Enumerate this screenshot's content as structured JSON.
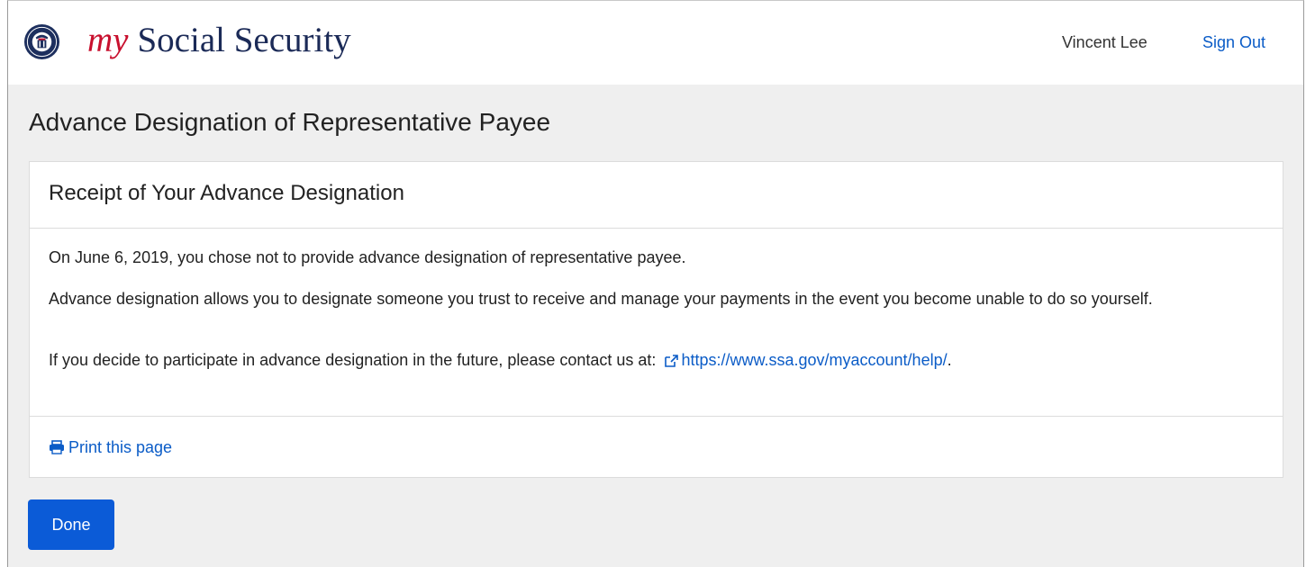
{
  "header": {
    "brand_my": "my",
    "brand_name": "Social Security",
    "user_name": "Vincent Lee",
    "signout_label": "Sign Out",
    "logo_icon": "ssa-seal-icon"
  },
  "page": {
    "title": "Advance Designation of Representative Payee"
  },
  "card": {
    "title": "Receipt of Your Advance Designation",
    "paragraph1": "On June 6, 2019, you chose not to provide advance designation of representative payee.",
    "paragraph2": "Advance designation allows you to designate someone you trust to receive and manage your payments in the event you become unable to do so yourself.",
    "paragraph3_prefix": "If you decide to participate in advance designation in the future, please contact us at:",
    "help_link": "https://www.ssa.gov/myaccount/help/",
    "paragraph3_suffix": ".",
    "external_icon": "external-link-icon",
    "print_label": "Print this page",
    "print_icon": "printer-icon"
  },
  "actions": {
    "done_label": "Done"
  },
  "colors": {
    "brand_red": "#c8102e",
    "brand_navy": "#1b2a57",
    "link_blue": "#0b5cc7",
    "button_blue": "#0b5bd7",
    "page_background": "#efefef"
  }
}
